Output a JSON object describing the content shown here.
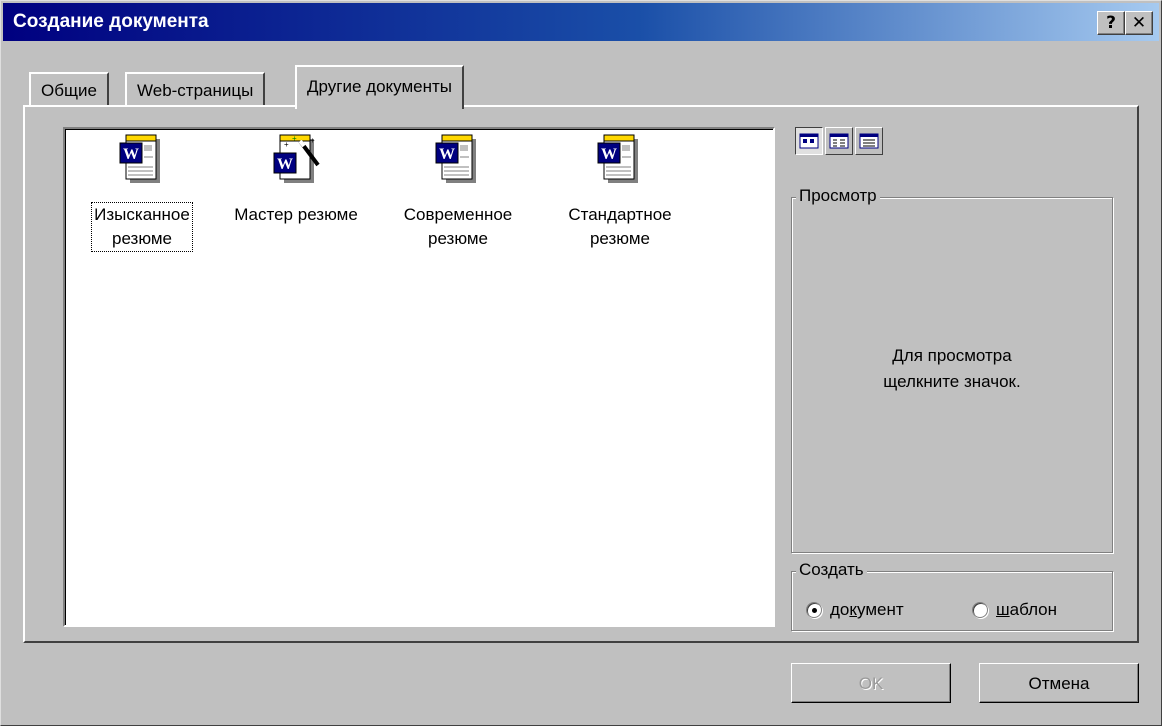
{
  "window": {
    "title": "Создание документа",
    "help_label": "?",
    "close_label": "✕"
  },
  "tabs": [
    {
      "label": "Общие",
      "active": false
    },
    {
      "label": "Web-страницы",
      "active": false
    },
    {
      "label": "Другие документы",
      "active": true
    }
  ],
  "documents": [
    {
      "label_line1": "Изысканное",
      "label_line2": "резюме",
      "icon": "word-document-icon",
      "selected": true
    },
    {
      "label_line1": "Мастер резюме",
      "label_line2": "",
      "icon": "word-wizard-icon",
      "selected": false
    },
    {
      "label_line1": "Современное",
      "label_line2": "резюме",
      "icon": "word-document-icon",
      "selected": false
    },
    {
      "label_line1": "Стандартное",
      "label_line2": "резюме",
      "icon": "word-document-icon",
      "selected": false
    }
  ],
  "view_buttons": [
    {
      "name": "large-icons-view",
      "pressed": true
    },
    {
      "name": "list-view",
      "pressed": false
    },
    {
      "name": "details-view",
      "pressed": false
    }
  ],
  "preview": {
    "legend": "Просмотр",
    "message_line1": "Для просмотра",
    "message_line2": "щелкните значок."
  },
  "create": {
    "legend": "Создать",
    "option_document": {
      "pre": "до",
      "accel": "к",
      "post": "умент",
      "checked": true
    },
    "option_template": {
      "pre": "",
      "accel": "ш",
      "post": "аблон",
      "checked": false
    }
  },
  "buttons": {
    "ok_label": "OK",
    "cancel_label": "Отмена"
  }
}
